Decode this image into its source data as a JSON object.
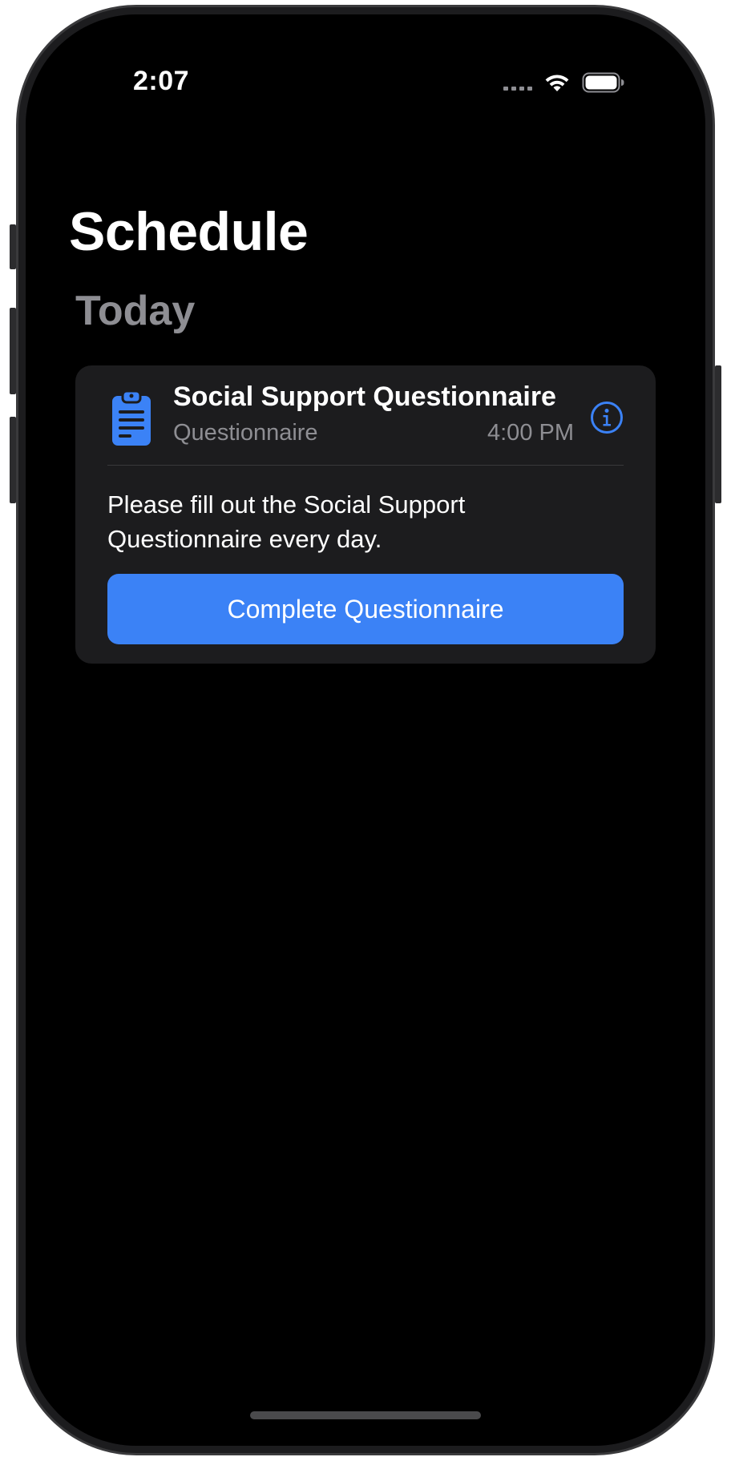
{
  "status_bar": {
    "time": "2:07"
  },
  "page": {
    "title": "Schedule"
  },
  "section": {
    "header": "Today"
  },
  "event_card": {
    "icon": "clipboard-icon",
    "title": "Social Support Questionnaire",
    "subtitle": "Questionnaire",
    "time": "4:00 PM",
    "description": "Please fill out the Social Support Questionnaire every day.",
    "action_label": "Complete Questionnaire"
  },
  "colors": {
    "accent": "#3b82f6",
    "background": "#000000",
    "card": "#1c1c1e",
    "secondary_text": "#8e8e93"
  }
}
